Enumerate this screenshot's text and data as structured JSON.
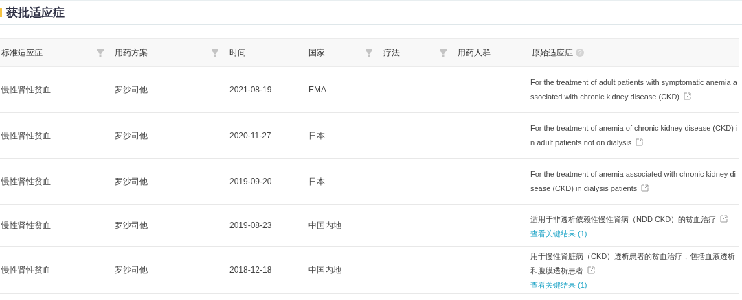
{
  "section": {
    "title": "获批适应症"
  },
  "table": {
    "columns": [
      {
        "label": "标准适应症",
        "kind": "filter"
      },
      {
        "label": "用药方案",
        "kind": "filter"
      },
      {
        "label": "时间",
        "kind": "plain"
      },
      {
        "label": "国家",
        "kind": "filter"
      },
      {
        "label": "疗法",
        "kind": "filter"
      },
      {
        "label": "用药人群",
        "kind": "plain"
      },
      {
        "label": "原始适应症",
        "kind": "help"
      }
    ],
    "rows": [
      {
        "cells": [
          "慢性肾性贫血",
          "罗沙司他",
          "2021-08-19",
          "EMA"
        ],
        "original": "For the treatment of adult patients with symptomatic anemia associated with chronic kidney disease (CKD)"
      },
      {
        "cells": [
          "慢性肾性贫血",
          "罗沙司他",
          "2020-11-27",
          "日本"
        ],
        "original": "For the treatment of anemia of chronic kidney disease (CKD) in adult patients not on dialysis"
      },
      {
        "cells": [
          "慢性肾性贫血",
          "罗沙司他",
          "2019-09-20",
          "日本"
        ],
        "original": "For the treatment of anemia associated with chronic kidney disease (CKD) in dialysis patients"
      },
      {
        "cells": [
          "慢性肾性贫血",
          "罗沙司他",
          "2019-08-23",
          "中国内地"
        ],
        "original": "适用于非透析依赖性慢性肾病（NDD CKD）的贫血治疗",
        "link": "查看关键结果 (1)"
      },
      {
        "cells": [
          "慢性肾性贫血",
          "罗沙司他",
          "2018-12-18",
          "中国内地"
        ],
        "original": "用于慢性肾脏病（CKD）透析患者的贫血治疗，包括血液透析和腹膜透析患者",
        "link": "查看关键结果 (1)"
      }
    ]
  }
}
